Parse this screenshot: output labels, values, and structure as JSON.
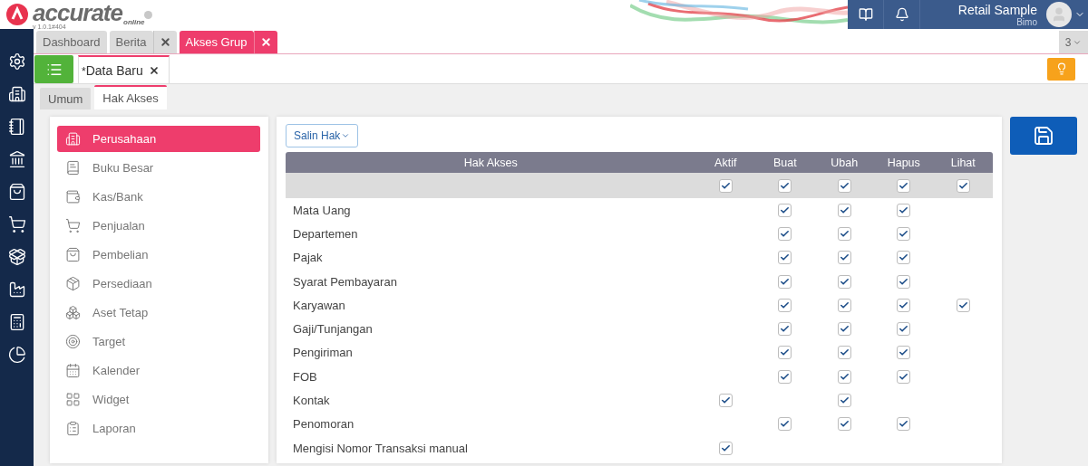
{
  "app": {
    "logo_text": "accurate",
    "logo_sub": "online",
    "version": "v 1.0.1#404"
  },
  "user": {
    "name": "Retail Sample",
    "subtitle": "Bimo"
  },
  "tabs": [
    {
      "label": "Dashboard",
      "selected": false,
      "closable": false
    },
    {
      "label": "Berita",
      "selected": false,
      "closable": true
    },
    {
      "label": "Akses Grup",
      "selected": true,
      "closable": true
    }
  ],
  "tab_count": "3",
  "doc_tab": {
    "marker": "*",
    "label": "Data Baru"
  },
  "subtabs": [
    {
      "label": "Umum",
      "selected": false
    },
    {
      "label": "Hak Akses",
      "selected": true
    }
  ],
  "modules": [
    {
      "label": "Perusahaan",
      "selected": true
    },
    {
      "label": "Buku Besar",
      "selected": false
    },
    {
      "label": "Kas/Bank",
      "selected": false
    },
    {
      "label": "Penjualan",
      "selected": false
    },
    {
      "label": "Pembelian",
      "selected": false
    },
    {
      "label": "Persediaan",
      "selected": false
    },
    {
      "label": "Aset Tetap",
      "selected": false
    },
    {
      "label": "Target",
      "selected": false
    },
    {
      "label": "Kalender",
      "selected": false
    },
    {
      "label": "Widget",
      "selected": false
    },
    {
      "label": "Laporan",
      "selected": false
    }
  ],
  "copy_button": "Salin Hak",
  "table": {
    "columns": [
      "Hak Akses",
      "Aktif",
      "Buat",
      "Ubah",
      "Hapus",
      "Lihat"
    ],
    "check_all": {
      "aktif": true,
      "buat": true,
      "ubah": true,
      "hapus": true,
      "lihat": true
    },
    "rows": [
      {
        "label": "Mata Uang",
        "buat": true,
        "ubah": true,
        "hapus": true
      },
      {
        "label": "Departemen",
        "buat": true,
        "ubah": true,
        "hapus": true
      },
      {
        "label": "Pajak",
        "buat": true,
        "ubah": true,
        "hapus": true
      },
      {
        "label": "Syarat Pembayaran",
        "buat": true,
        "ubah": true,
        "hapus": true
      },
      {
        "label": "Karyawan",
        "buat": true,
        "ubah": true,
        "hapus": true,
        "lihat": true
      },
      {
        "label": "Gaji/Tunjangan",
        "buat": true,
        "ubah": true,
        "hapus": true
      },
      {
        "label": "Pengiriman",
        "buat": true,
        "ubah": true,
        "hapus": true
      },
      {
        "label": "FOB",
        "buat": true,
        "ubah": true,
        "hapus": true
      },
      {
        "label": "Kontak",
        "aktif": true,
        "ubah": true
      },
      {
        "label": "Penomoran",
        "buat": true,
        "ubah": true,
        "hapus": true
      },
      {
        "label": "Mengisi Nomor Transaksi manual",
        "aktif": true
      }
    ]
  }
}
